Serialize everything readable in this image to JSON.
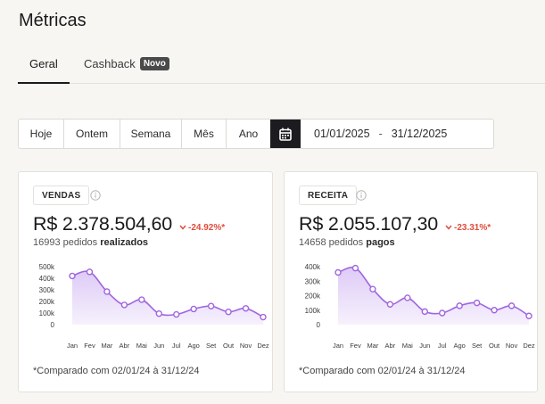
{
  "page": {
    "title": "Métricas"
  },
  "tabs": [
    {
      "label": "Geral",
      "active": true
    },
    {
      "label": "Cashback",
      "badge": "Novo"
    }
  ],
  "period": {
    "options": [
      "Hoje",
      "Ontem",
      "Semana",
      "Mês",
      "Ano"
    ],
    "calendar_icon": "calendar-icon",
    "date_start": "01/01/2025",
    "date_separator": "-",
    "date_end": "31/12/2025"
  },
  "colors": {
    "accent": "#a065e0",
    "fill": "#dcc8f6",
    "negative": "#e14b3c"
  },
  "cards": [
    {
      "tag": "VENDAS",
      "value": "R$ 2.378.504,60",
      "delta": "-24.92%*",
      "sub_count": "16993 pedidos",
      "sub_bold": "realizados",
      "footnote": "*Comparado com 02/01/24 à 31/12/24",
      "chart_data": {
        "type": "area",
        "categories": [
          "Jan",
          "Fev",
          "Mar",
          "Abr",
          "Mai",
          "Jun",
          "Jul",
          "Ago",
          "Set",
          "Out",
          "Nov",
          "Dez"
        ],
        "y_ticks": [
          "500k",
          "400k",
          "300k",
          "200k",
          "100k",
          "0"
        ],
        "ylim": [
          0,
          500000
        ],
        "values": [
          420000,
          455000,
          285000,
          170000,
          215000,
          95000,
          88000,
          135000,
          160000,
          110000,
          140000,
          65000
        ]
      }
    },
    {
      "tag": "RECEITA",
      "value": "R$ 2.055.107,30",
      "delta": "-23.31%*",
      "sub_count": "14658 pedidos",
      "sub_bold": "pagos",
      "footnote": "*Comparado com 02/01/24 à 31/12/24",
      "chart_data": {
        "type": "area",
        "categories": [
          "Jan",
          "Fev",
          "Mar",
          "Abr",
          "Mai",
          "Jun",
          "Jul",
          "Ago",
          "Set",
          "Out",
          "Nov",
          "Dez"
        ],
        "y_ticks": [
          "400k",
          "300k",
          "200k",
          "100k",
          "0"
        ],
        "ylim": [
          0,
          400000
        ],
        "values": [
          360000,
          390000,
          245000,
          140000,
          185000,
          90000,
          80000,
          130000,
          150000,
          100000,
          130000,
          60000
        ]
      }
    }
  ]
}
